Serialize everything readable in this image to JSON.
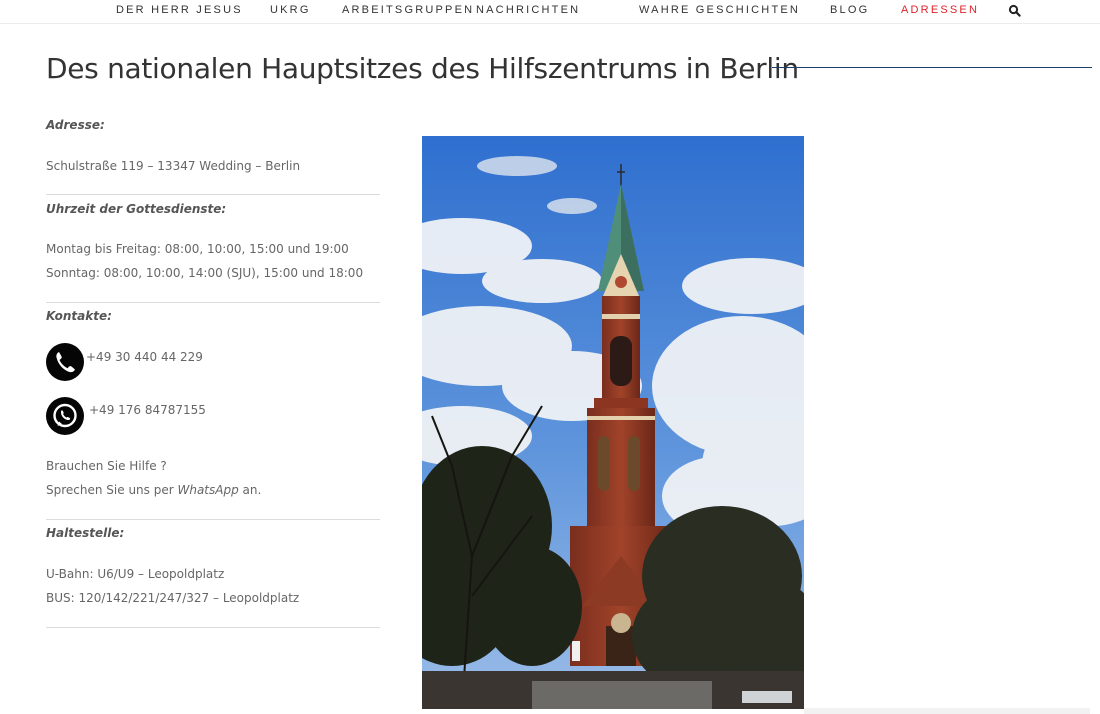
{
  "nav": {
    "items": [
      {
        "label": "DER HERR JESUS"
      },
      {
        "label": "UKRG"
      },
      {
        "label": "ARBEITSGRUPPEN"
      },
      {
        "label": "NACHRICHTEN"
      },
      {
        "label": "WAHRE GESCHICHTEN"
      },
      {
        "label": "BLOG"
      },
      {
        "label": "ADRESSEN"
      }
    ],
    "active_index": 6,
    "search_icon": "search-icon"
  },
  "page": {
    "title": "Des nationalen Hauptsitzes des Hilfszentrums in Berlin"
  },
  "address": {
    "heading": "Adresse:",
    "text": "Schulstraße 119  – 13347  Wedding – Berlin"
  },
  "services": {
    "heading": "Uhrzeit der Gottesdienste:",
    "weekdays": "Montag bis Freitag: 08:00, 10:00, 15:00 und 19:00",
    "sunday": "Sonntag: 08:00, 10:00, 14:00 (SJU), 15:00 und 18:00"
  },
  "contacts": {
    "heading": "Kontakte:",
    "phone": "+49 30 440 44 229",
    "whatsapp": "+49 176 84787155",
    "help_line1": "Brauchen Sie Hilfe ?",
    "help_line2_prefix": "Sprechen Sie uns per ",
    "help_line2_em": "WhatsApp",
    "help_line2_suffix": " an."
  },
  "transit": {
    "heading": "Haltestelle:",
    "ubahn": "U-Bahn: U6/U9 – Leopoldplatz",
    "bus": "BUS: 120/142/221/247/327 – Leopoldplatz"
  },
  "colors": {
    "accent_red": "#e0232a",
    "title_rule": "#1e3f6a"
  }
}
